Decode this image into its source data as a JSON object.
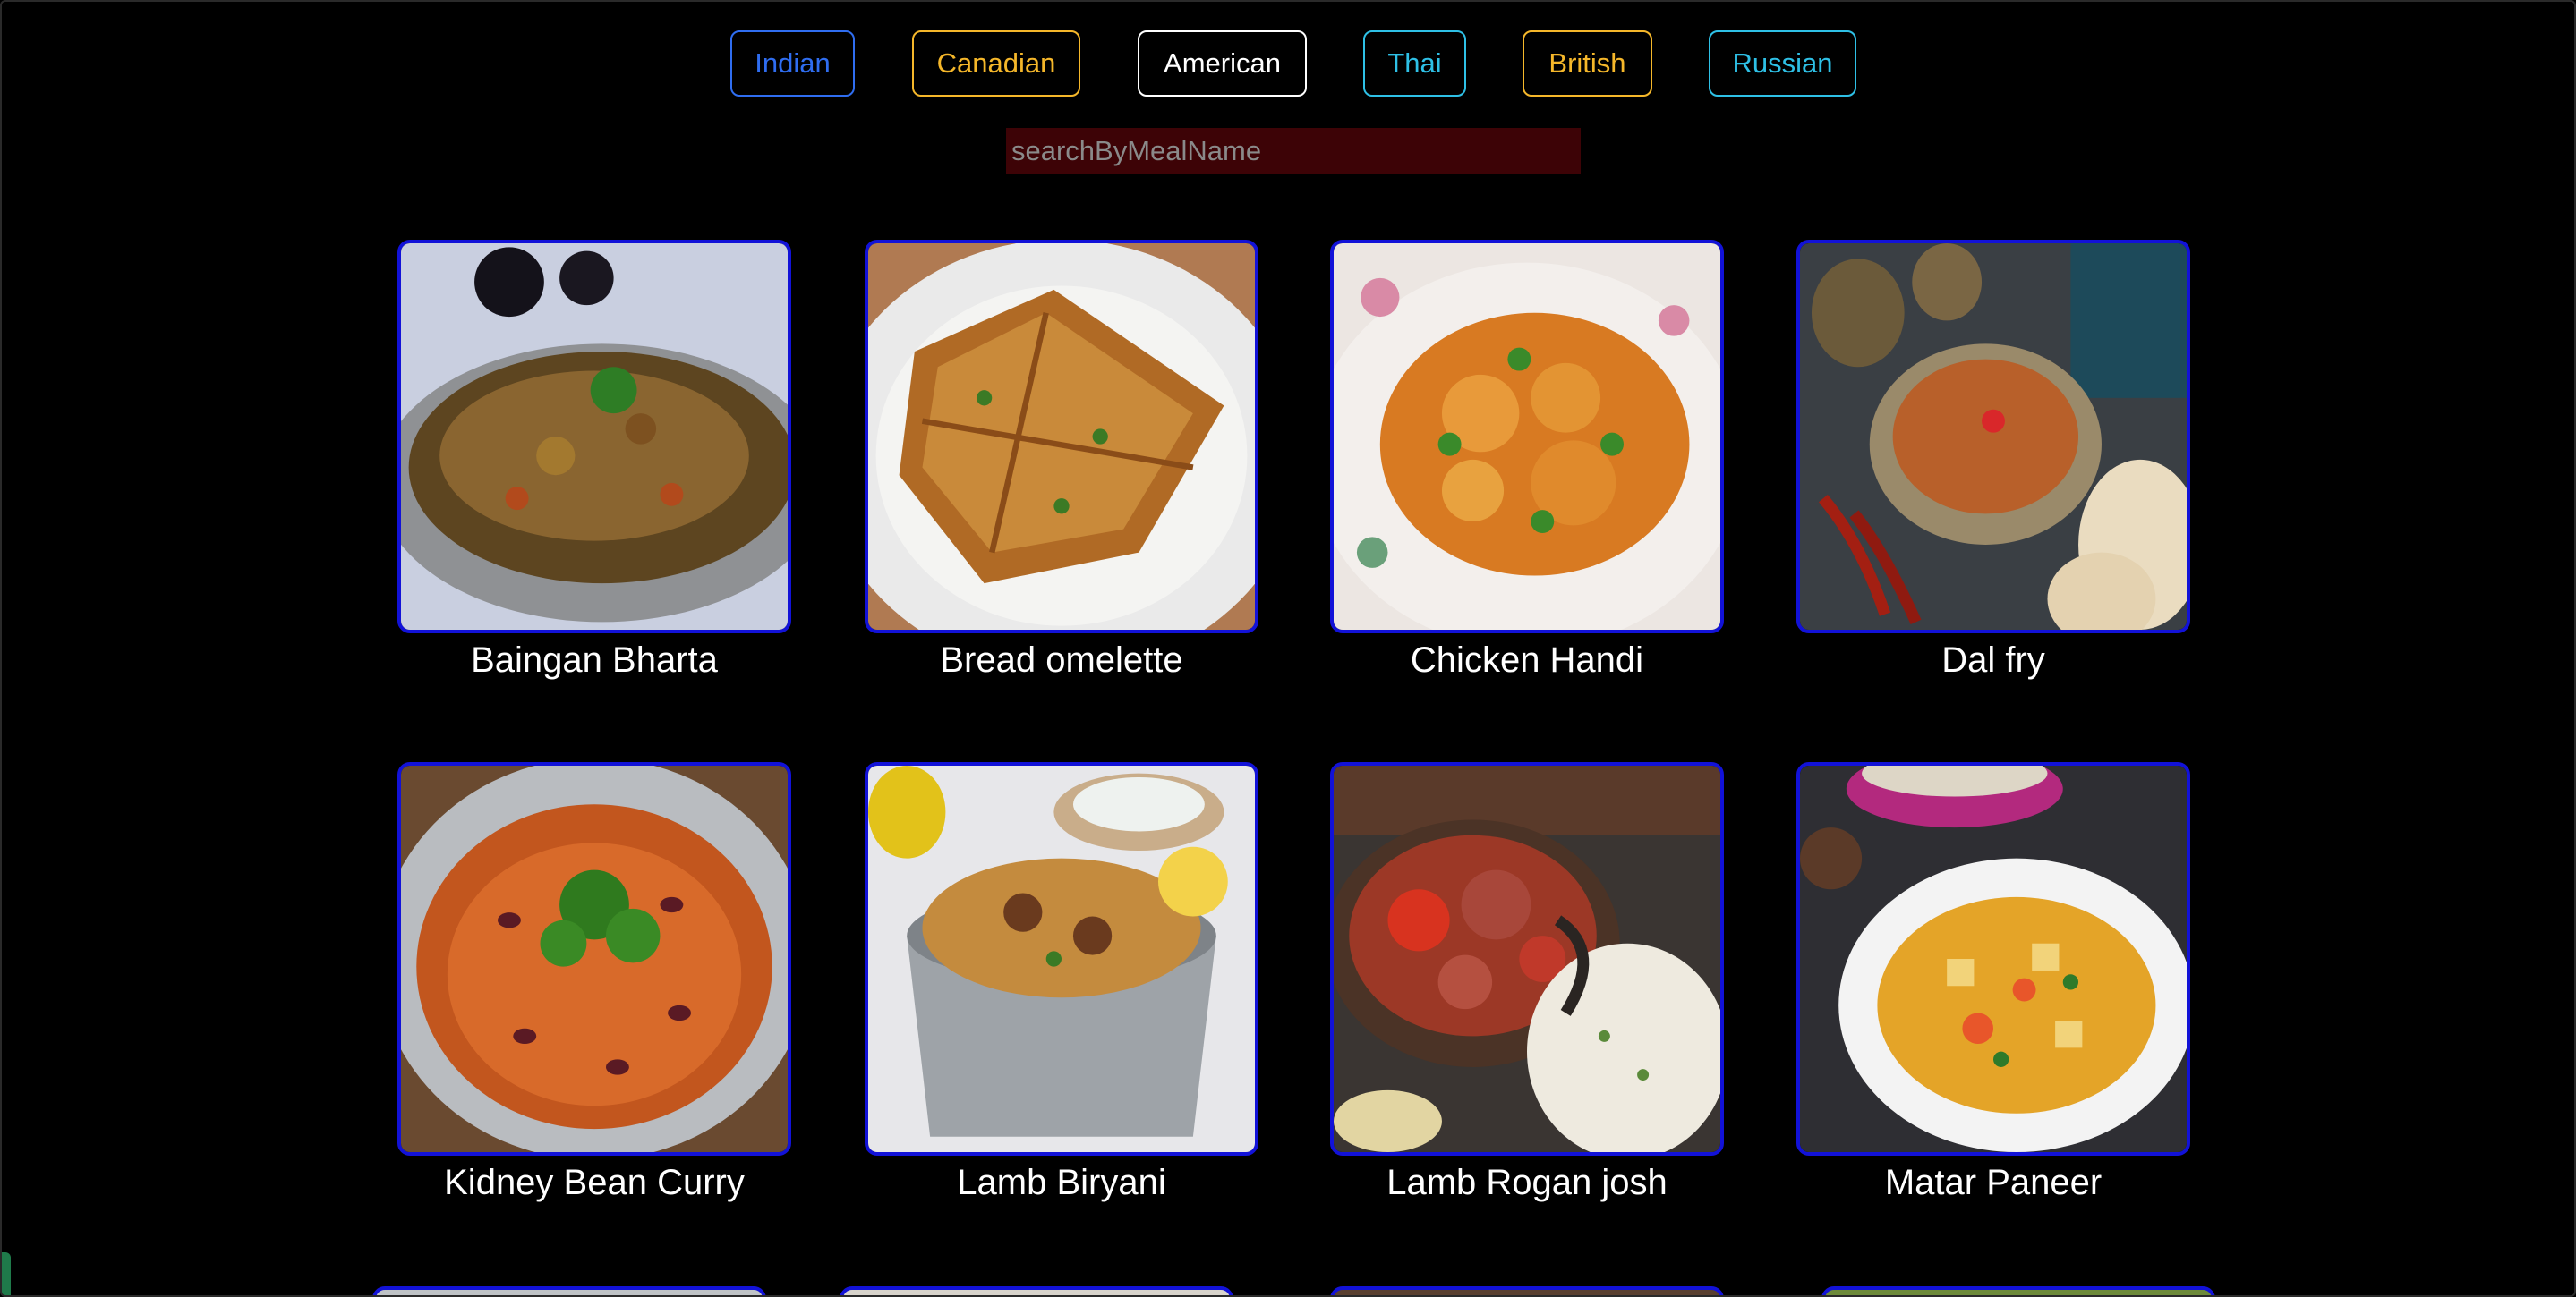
{
  "filters": [
    {
      "label": "Indian",
      "color": "#2f6df0"
    },
    {
      "label": "Canadian",
      "color": "#f5b72a"
    },
    {
      "label": "American",
      "color": "#ffffff"
    },
    {
      "label": "Thai",
      "color": "#2ec0e6"
    },
    {
      "label": "British",
      "color": "#f5b72a"
    },
    {
      "label": "Russian",
      "color": "#2ec0e6"
    }
  ],
  "search": {
    "placeholder": "searchByMealName",
    "value": ""
  },
  "meals": [
    {
      "name": "Baingan Bharta"
    },
    {
      "name": "Bread omelette"
    },
    {
      "name": "Chicken Handi"
    },
    {
      "name": "Dal fry"
    },
    {
      "name": "Kidney Bean Curry"
    },
    {
      "name": "Lamb Biryani"
    },
    {
      "name": "Lamb Rogan josh"
    },
    {
      "name": "Matar Paneer"
    }
  ],
  "colors": {
    "card_border": "#1212d8",
    "search_bg": "#3d0306",
    "background": "#000000"
  }
}
